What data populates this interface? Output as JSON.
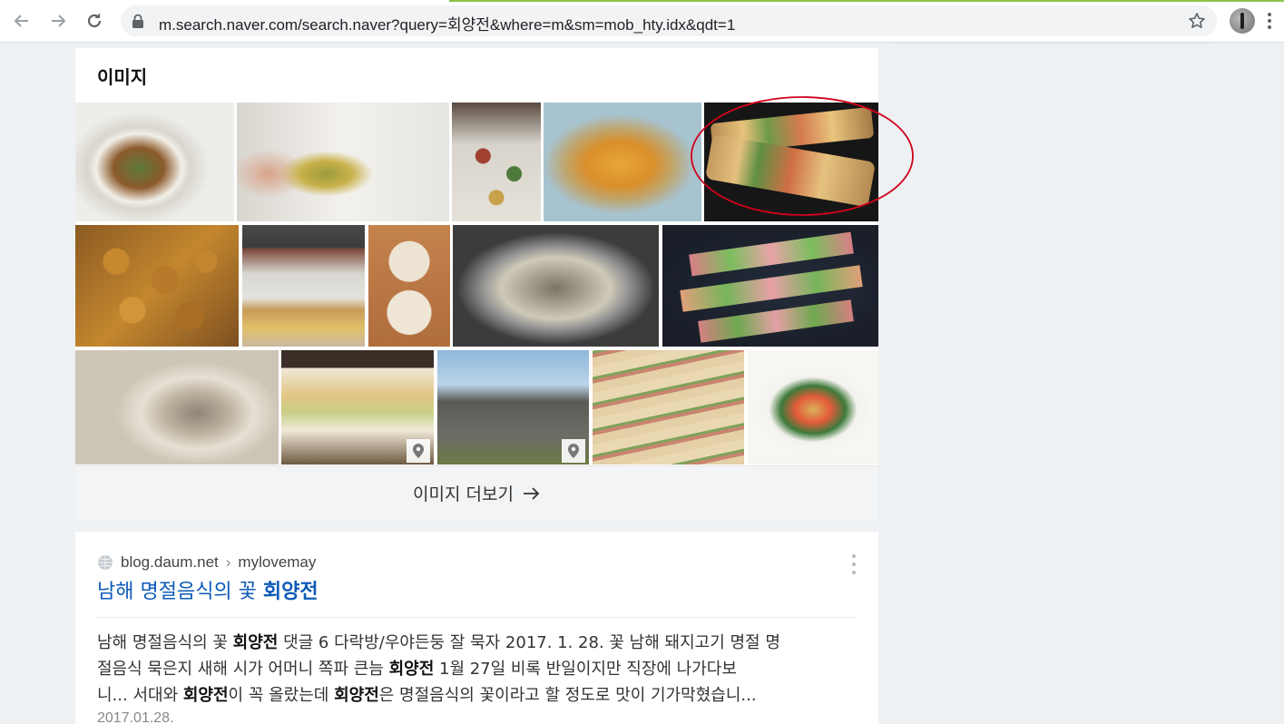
{
  "browser": {
    "url": "m.search.naver.com/search.naver?query=회양전&where=m&sm=mob_hty.idx&qdt=1",
    "icons": {
      "back": "arrow-left-icon",
      "forward": "arrow-right-icon",
      "reload": "reload-icon",
      "secure": "lock-icon",
      "bookmark": "star-icon",
      "profile": "avatar",
      "menu": "kebab-menu-icon"
    },
    "load_color": "#8bc34a"
  },
  "image_section": {
    "title": "이미지",
    "more_label": "이미지 더보기",
    "more_icon": "arrow-right-icon",
    "highlight_color": "#d0021b",
    "highlighted_tile": "row-1 image 5",
    "pin_icon": "location-pin-icon"
  },
  "result": {
    "favicon": "globe-icon",
    "site": "blog.daum.net",
    "separator": "›",
    "path": "mylovemay",
    "title_prefix": "남해 명절음식의 꽃 ",
    "title_keyword": "회양전",
    "snippet_line1_a": "남해 명절음식의 꽃 ",
    "snippet_line1_b": "회양전",
    "snippet_line1_c": " 댓글 6 다락방/우야든둥 잘 묵자 2017. 1. 28. 꽃 남해 돼지고기 명절 명",
    "snippet_line2_a": "절음식 묵은지 새해 시가 어머니 쪽파 큰늠 ",
    "snippet_line2_b": "회양전",
    "snippet_line2_c": " 1월 27일 비록 반일이지만 직장에 나가다보",
    "snippet_line3_a": "니... 서대와 ",
    "snippet_line3_b": "회양전",
    "snippet_line3_c": "이 꼭 올랐는데 ",
    "snippet_line3_d": "회양전",
    "snippet_line3_e": "은 명절음식의 꽃이라고 할 정도로 맛이 기가막혔습니...",
    "date": "2017.01.28.",
    "more_icon": "kebab-menu-icon"
  }
}
